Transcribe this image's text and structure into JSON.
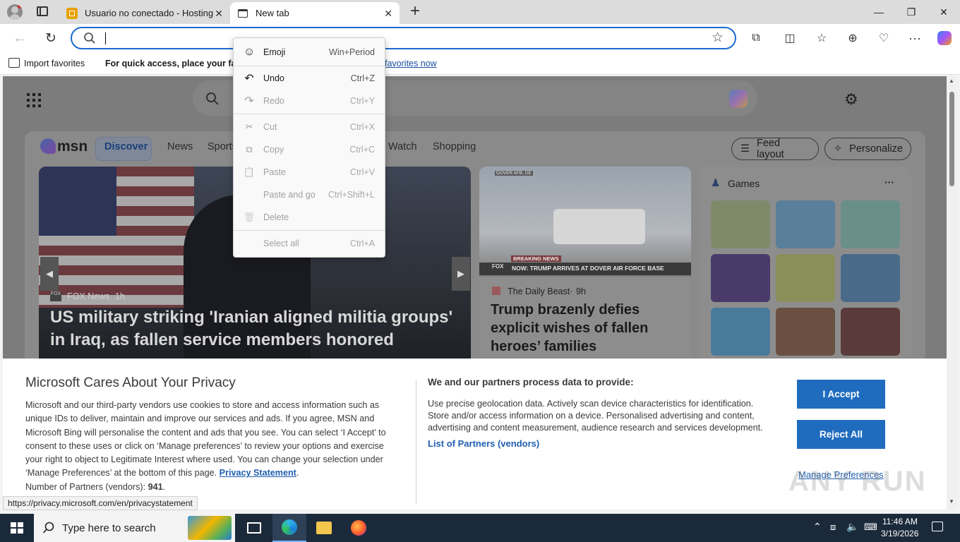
{
  "browser": {
    "tabs": [
      {
        "title": "Usuario no conectado - Hosting",
        "active": false
      },
      {
        "title": "New tab",
        "active": true
      }
    ],
    "new_tab_symbol": "+",
    "window_controls": {
      "minimize": "—",
      "maximize": "❐",
      "close": "✕"
    },
    "favorites_bar": {
      "import": "Import favorites",
      "hint": "For quick access, place your favor",
      "hint_link": "favorites now"
    }
  },
  "context_menu": {
    "items": [
      {
        "label": "Emoji",
        "shortcut": "Win+Period",
        "icon": "☺",
        "disabled": false
      },
      {
        "label": "Undo",
        "shortcut": "Ctrl+Z",
        "icon": "↶",
        "disabled": false
      },
      {
        "label": "Redo",
        "shortcut": "Ctrl+Y",
        "icon": "↷",
        "disabled": true
      },
      {
        "label": "Cut",
        "shortcut": "Ctrl+X",
        "icon": "✂",
        "disabled": true
      },
      {
        "label": "Copy",
        "shortcut": "Ctrl+C",
        "icon": "⧉",
        "disabled": true
      },
      {
        "label": "Paste",
        "shortcut": "Ctrl+V",
        "icon": "📋",
        "disabled": true
      },
      {
        "label": "Paste and go",
        "shortcut": "Ctrl+Shift+L",
        "icon": "",
        "disabled": true
      },
      {
        "label": "Delete",
        "shortcut": "",
        "icon": "🗑",
        "disabled": true
      },
      {
        "label": "Select all",
        "shortcut": "Ctrl+A",
        "icon": "",
        "disabled": true
      }
    ]
  },
  "msn": {
    "logo": "msn",
    "nav": [
      "Discover",
      "News",
      "Sports",
      "Watch",
      "Shopping"
    ],
    "feed_layout": "Feed layout",
    "personalize": "Personalize",
    "hero": {
      "source": "FOX News",
      "age": "1h",
      "headline": "US military striking 'Iranian aligned militia groups' in Iraq, as fallen service members honored"
    },
    "story2": {
      "source": "The Daily Beast",
      "age": "9h",
      "headline": "Trump brazenly defies explicit wishes of fallen heroes’ families",
      "ticker": "NOW: TRUMP ARRIVES AT DOVER AIR FORCE BASE",
      "breaking": "BREAKING NEWS",
      "dateline": "DOVER AFB, DE"
    },
    "games_title": "Games",
    "more": "···"
  },
  "privacy": {
    "title": "Microsoft Cares About Your Privacy",
    "body": "Microsoft and our third-party vendors use cookies to store and access information such as unique IDs to deliver, maintain and improve our services and ads. If you agree, MSN and Microsoft Bing will personalise the content and ads that you see. You can select ‘I Accept’ to consent to these uses or click on ‘Manage preferences’ to review your options and exercise your right to object to Legitimate Interest where used.  You can change your selection under ‘Manage Preferences’ at the bottom of this page.",
    "privacy_link": "Privacy Statement",
    "partners_label": "Number of Partners (vendors):",
    "partners_count": "941",
    "right_title": "We and our partners process data to provide:",
    "right_body": "Use precise geolocation data. Actively scan device characteristics for identification. Store and/or access information on a device. Personalised advertising and content, advertising and content measurement, audience research and services development.",
    "partners_link": "List of Partners (vendors)",
    "accept": "I Accept",
    "reject": "Reject All",
    "manage": "Manage Preferences"
  },
  "status_url": "https://privacy.microsoft.com/en/privacystatement",
  "taskbar": {
    "search_placeholder": "Type here to search",
    "time": "11:46 AM",
    "date": "3/19/2026"
  },
  "watermark": "ANY RUN"
}
